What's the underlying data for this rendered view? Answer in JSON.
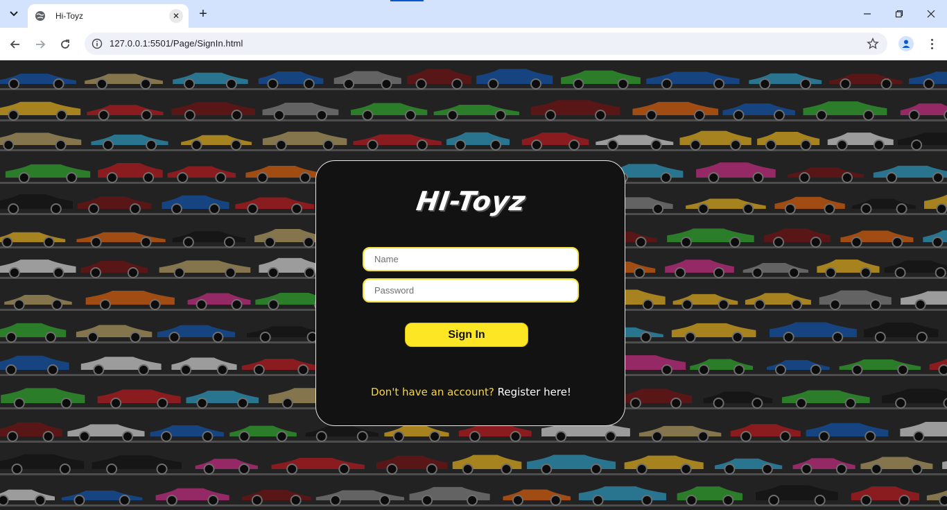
{
  "browser": {
    "tab_title": "Hi-Toyz",
    "url": "127.0.0.1:5501/Page/SignIn.html",
    "new_tab_symbol": "+",
    "close_tab_symbol": "✕"
  },
  "signin": {
    "logo": "HI-Toyz",
    "name_placeholder": "Name",
    "password_placeholder": "Password",
    "button_label": "Sign In",
    "register_question": "Don't have an account?",
    "register_link": "Register here!"
  },
  "colors": {
    "accent_yellow": "#fde724",
    "card_bg": "#121212",
    "tabbar": "#d3e3fd"
  },
  "icons": [
    "tab-search-icon",
    "globe-favicon-icon",
    "close-icon",
    "plus-icon",
    "minimize-icon",
    "restore-icon",
    "close-window-icon",
    "back-arrow-icon",
    "forward-arrow-icon",
    "reload-icon",
    "info-icon",
    "star-icon",
    "profile-icon",
    "menu-dots-icon"
  ]
}
